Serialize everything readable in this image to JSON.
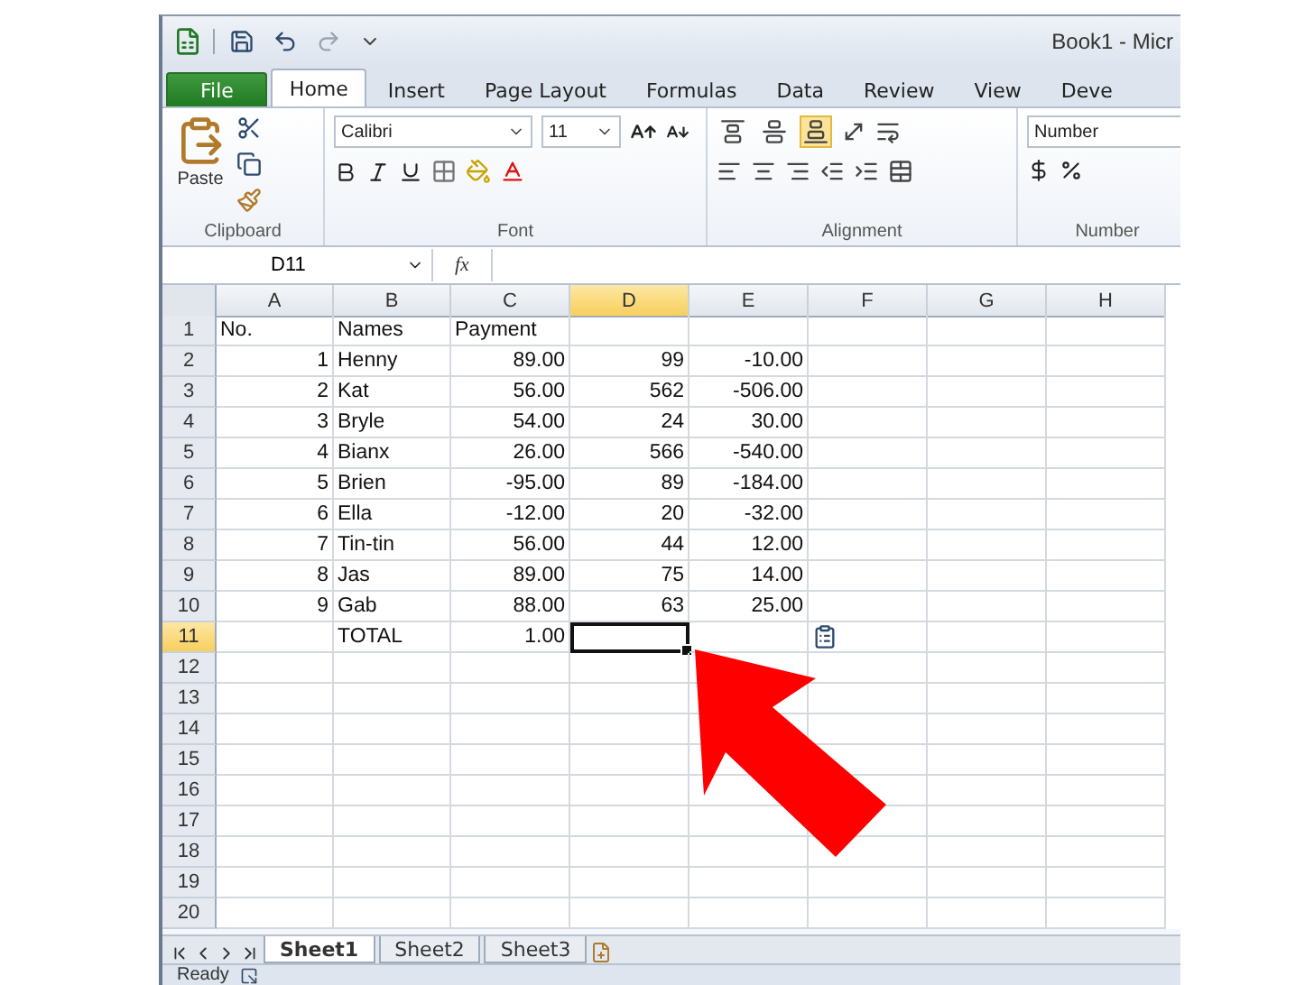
{
  "title_bar": {
    "title": "Book1 - Micr"
  },
  "tabs": [
    {
      "label": "File",
      "kind": "file",
      "selected": false
    },
    {
      "label": "Home",
      "kind": "tab",
      "selected": true
    },
    {
      "label": "Insert",
      "kind": "tab",
      "selected": false
    },
    {
      "label": "Page Layout",
      "kind": "tab",
      "selected": false
    },
    {
      "label": "Formulas",
      "kind": "tab",
      "selected": false
    },
    {
      "label": "Data",
      "kind": "tab",
      "selected": false
    },
    {
      "label": "Review",
      "kind": "tab",
      "selected": false
    },
    {
      "label": "View",
      "kind": "tab",
      "selected": false
    },
    {
      "label": "Deve",
      "kind": "tab",
      "selected": false
    }
  ],
  "ribbon": {
    "clipboard": {
      "paste": "Paste",
      "label": "Clipboard"
    },
    "font": {
      "name": "Calibri",
      "size": "11",
      "label": "Font"
    },
    "alignment": {
      "label": "Alignment",
      "vertical_align": [
        {
          "kind": "top",
          "selected": false
        },
        {
          "kind": "middle",
          "selected": false
        },
        {
          "kind": "bottom",
          "selected": true
        }
      ]
    },
    "number": {
      "format": "Number",
      "label": "Number"
    }
  },
  "formula_bar": {
    "name_box": "D11",
    "function_label": "fx"
  },
  "columns": [
    {
      "label": "A",
      "selected": false
    },
    {
      "label": "B",
      "selected": false
    },
    {
      "label": "C",
      "selected": false
    },
    {
      "label": "D",
      "selected": true
    },
    {
      "label": "E",
      "selected": false
    },
    {
      "label": "F",
      "selected": false
    },
    {
      "label": "G",
      "selected": false
    },
    {
      "label": "H",
      "selected": false
    }
  ],
  "rows": [
    {
      "header": "1",
      "selected": false,
      "cells": [
        {
          "text": "No.",
          "numeric": false
        },
        {
          "text": "Names",
          "numeric": false
        },
        {
          "text": "Payment",
          "numeric": false
        }
      ]
    },
    {
      "header": "2",
      "selected": false,
      "cells": [
        {
          "text": "1",
          "numeric": true
        },
        {
          "text": "Henny",
          "numeric": false
        },
        {
          "text": "89.00",
          "numeric": true
        },
        {
          "text": "99",
          "numeric": true
        },
        {
          "text": "-10.00",
          "numeric": true
        }
      ]
    },
    {
      "header": "3",
      "selected": false,
      "cells": [
        {
          "text": "2",
          "numeric": true
        },
        {
          "text": "Kat",
          "numeric": false
        },
        {
          "text": "56.00",
          "numeric": true
        },
        {
          "text": "562",
          "numeric": true
        },
        {
          "text": "-506.00",
          "numeric": true
        }
      ]
    },
    {
      "header": "4",
      "selected": false,
      "cells": [
        {
          "text": "3",
          "numeric": true
        },
        {
          "text": "Bryle",
          "numeric": false
        },
        {
          "text": "54.00",
          "numeric": true
        },
        {
          "text": "24",
          "numeric": true
        },
        {
          "text": "30.00",
          "numeric": true
        }
      ]
    },
    {
      "header": "5",
      "selected": false,
      "cells": [
        {
          "text": "4",
          "numeric": true
        },
        {
          "text": "Bianx",
          "numeric": false
        },
        {
          "text": "26.00",
          "numeric": true
        },
        {
          "text": "566",
          "numeric": true
        },
        {
          "text": "-540.00",
          "numeric": true
        }
      ]
    },
    {
      "header": "6",
      "selected": false,
      "cells": [
        {
          "text": "5",
          "numeric": true
        },
        {
          "text": "Brien",
          "numeric": false
        },
        {
          "text": "-95.00",
          "numeric": true
        },
        {
          "text": "89",
          "numeric": true
        },
        {
          "text": "-184.00",
          "numeric": true
        }
      ]
    },
    {
      "header": "7",
      "selected": false,
      "cells": [
        {
          "text": "6",
          "numeric": true
        },
        {
          "text": "Ella",
          "numeric": false
        },
        {
          "text": "-12.00",
          "numeric": true
        },
        {
          "text": "20",
          "numeric": true
        },
        {
          "text": "-32.00",
          "numeric": true
        }
      ]
    },
    {
      "header": "8",
      "selected": false,
      "cells": [
        {
          "text": "7",
          "numeric": true
        },
        {
          "text": "Tin-tin",
          "numeric": false
        },
        {
          "text": "56.00",
          "numeric": true
        },
        {
          "text": "44",
          "numeric": true
        },
        {
          "text": "12.00",
          "numeric": true
        }
      ]
    },
    {
      "header": "9",
      "selected": false,
      "cells": [
        {
          "text": "8",
          "numeric": true
        },
        {
          "text": "Jas",
          "numeric": false
        },
        {
          "text": "89.00",
          "numeric": true
        },
        {
          "text": "75",
          "numeric": true
        },
        {
          "text": "14.00",
          "numeric": true
        }
      ]
    },
    {
      "header": "10",
      "selected": false,
      "cells": [
        {
          "text": "9",
          "numeric": true
        },
        {
          "text": "Gab",
          "numeric": false
        },
        {
          "text": "88.00",
          "numeric": true
        },
        {
          "text": "63",
          "numeric": true
        },
        {
          "text": "25.00",
          "numeric": true
        }
      ]
    },
    {
      "header": "11",
      "selected": true,
      "paste_options": true,
      "cells": [
        null,
        {
          "text": "TOTAL",
          "numeric": false
        },
        {
          "text": "1.00",
          "numeric": true
        }
      ]
    },
    {
      "header": "12",
      "selected": false
    },
    {
      "header": "13",
      "selected": false
    },
    {
      "header": "14",
      "selected": false
    },
    {
      "header": "15",
      "selected": false
    },
    {
      "header": "16",
      "selected": false
    },
    {
      "header": "17",
      "selected": false
    },
    {
      "header": "18",
      "selected": false
    },
    {
      "header": "19",
      "selected": false
    },
    {
      "header": "20",
      "selected": false
    }
  ],
  "annotation": {
    "arrow": true
  },
  "sheet_tabs": [
    {
      "label": "Sheet1",
      "selected": true
    },
    {
      "label": "Sheet2",
      "selected": false
    },
    {
      "label": "Sheet3",
      "selected": false
    }
  ],
  "status_bar": {
    "text": "Ready"
  }
}
